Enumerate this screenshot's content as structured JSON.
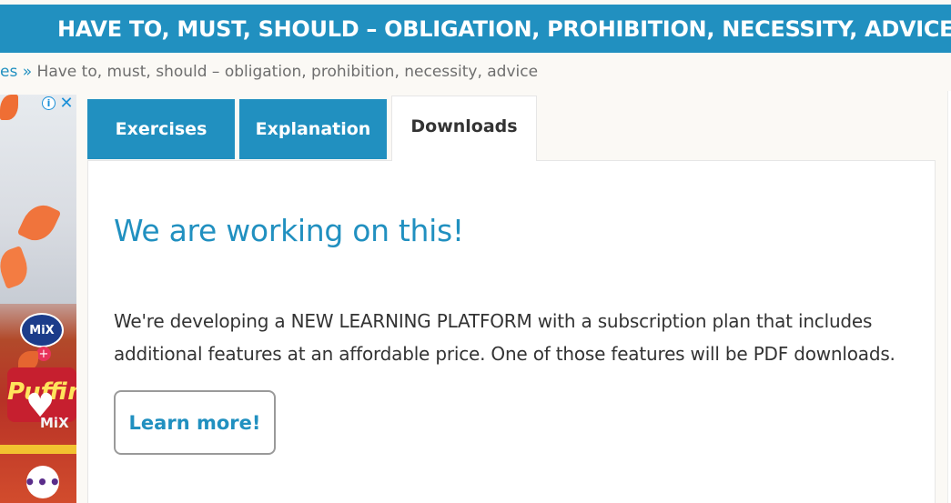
{
  "header": {
    "title": "HAVE TO, MUST, SHOULD – OBLIGATION, PROHIBITION, NECESSITY, ADVICE"
  },
  "breadcrumb": {
    "prev": "es",
    "separator": "»",
    "current": "Have to, must, should – obligation, prohibition, necessity, advice"
  },
  "ad": {
    "logo_text": "MiX",
    "logo_text_2": "MiX",
    "candy_text": "Puffin",
    "info_icon": "info-icon",
    "close_icon": "close-icon"
  },
  "tabs": [
    {
      "label": "Exercises"
    },
    {
      "label": "Explanation"
    },
    {
      "label": "Downloads"
    }
  ],
  "content": {
    "heading": "We are working on this!",
    "body": "We're developing a NEW LEARNING PLATFORM with a subscription plan that includes additional features at an affordable price. One of those features will be PDF downloads.",
    "button_label": "Learn more!"
  },
  "colors": {
    "brand_blue": "#2190c0",
    "text_dark": "#333333"
  }
}
